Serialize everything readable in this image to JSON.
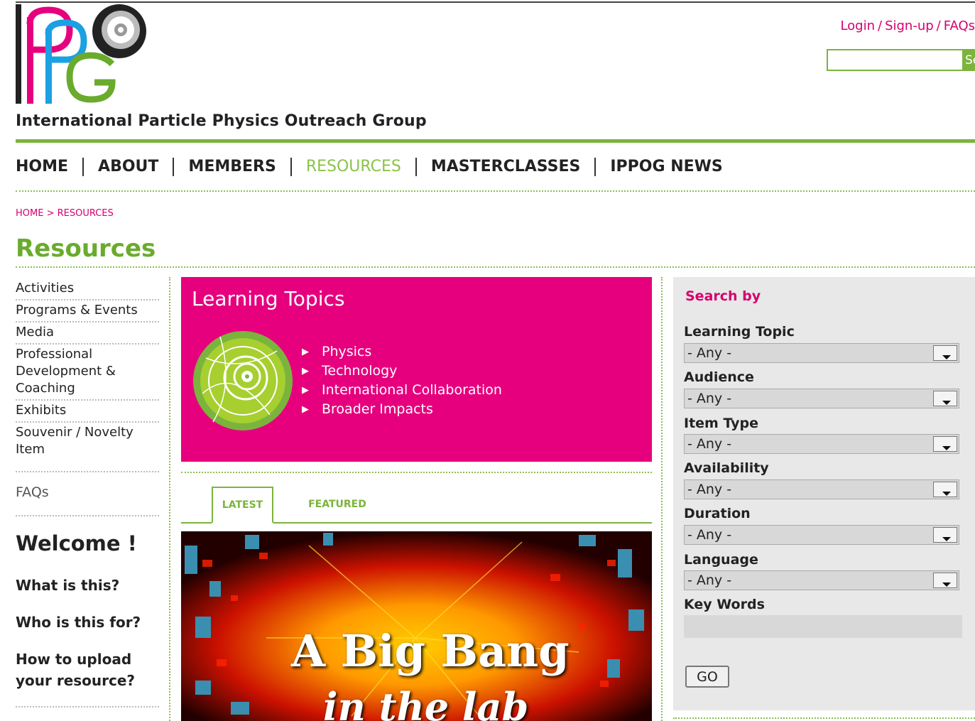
{
  "header": {
    "org_name": "International Particle Physics Outreach Group",
    "top_links": [
      "Login",
      "Sign-up",
      "FAQs"
    ],
    "link_separator": "/",
    "search_button": "Search",
    "search_placeholder": ""
  },
  "nav": {
    "items": [
      "HOME",
      "ABOUT",
      "MEMBERS",
      "RESOURCES",
      "MASTERCLASSES",
      "IPPOG NEWS"
    ],
    "active": "RESOURCES"
  },
  "breadcrumb": "HOME > RESOURCES",
  "page_title": "Resources",
  "sidebar": {
    "items": [
      "Activities",
      "Programs & Events",
      "Media",
      "Professional Development & Coaching",
      "Exhibits",
      "Souvenir / Novelty Item"
    ],
    "faqs": "FAQs",
    "welcome": "Welcome !",
    "questions": [
      "What is this?",
      "Who is this for?",
      "How to upload your resource?"
    ]
  },
  "topics": {
    "title": "Learning Topics",
    "items": [
      "Physics",
      "Technology",
      "International Collaboration",
      "Broader Impacts"
    ]
  },
  "tabs": {
    "latest": "LATEST",
    "featured": "FEATURED"
  },
  "banner": {
    "title": "A Big Bang",
    "subtitle": "in the lab"
  },
  "search_panel": {
    "heading": "Search by",
    "fields": [
      {
        "label": "Learning Topic",
        "value": "- Any -"
      },
      {
        "label": "Audience",
        "value": "- Any -"
      },
      {
        "label": "Item Type",
        "value": "- Any -"
      },
      {
        "label": "Availability",
        "value": "- Any -"
      },
      {
        "label": "Duration",
        "value": "- Any -"
      },
      {
        "label": "Language",
        "value": "- Any -"
      }
    ],
    "keywords_label": "Key Words",
    "go_button": "GO"
  },
  "colors": {
    "magenta": "#e6007e",
    "link_pink": "#d4006e",
    "green": "#7bb43c",
    "title_green": "#6aab2d",
    "panel_bg": "#e8e8e8"
  },
  "icons": [
    "ippog-logo",
    "detector-event-icon",
    "triangle-bullet-icon",
    "dropdown-arrow-icon"
  ]
}
